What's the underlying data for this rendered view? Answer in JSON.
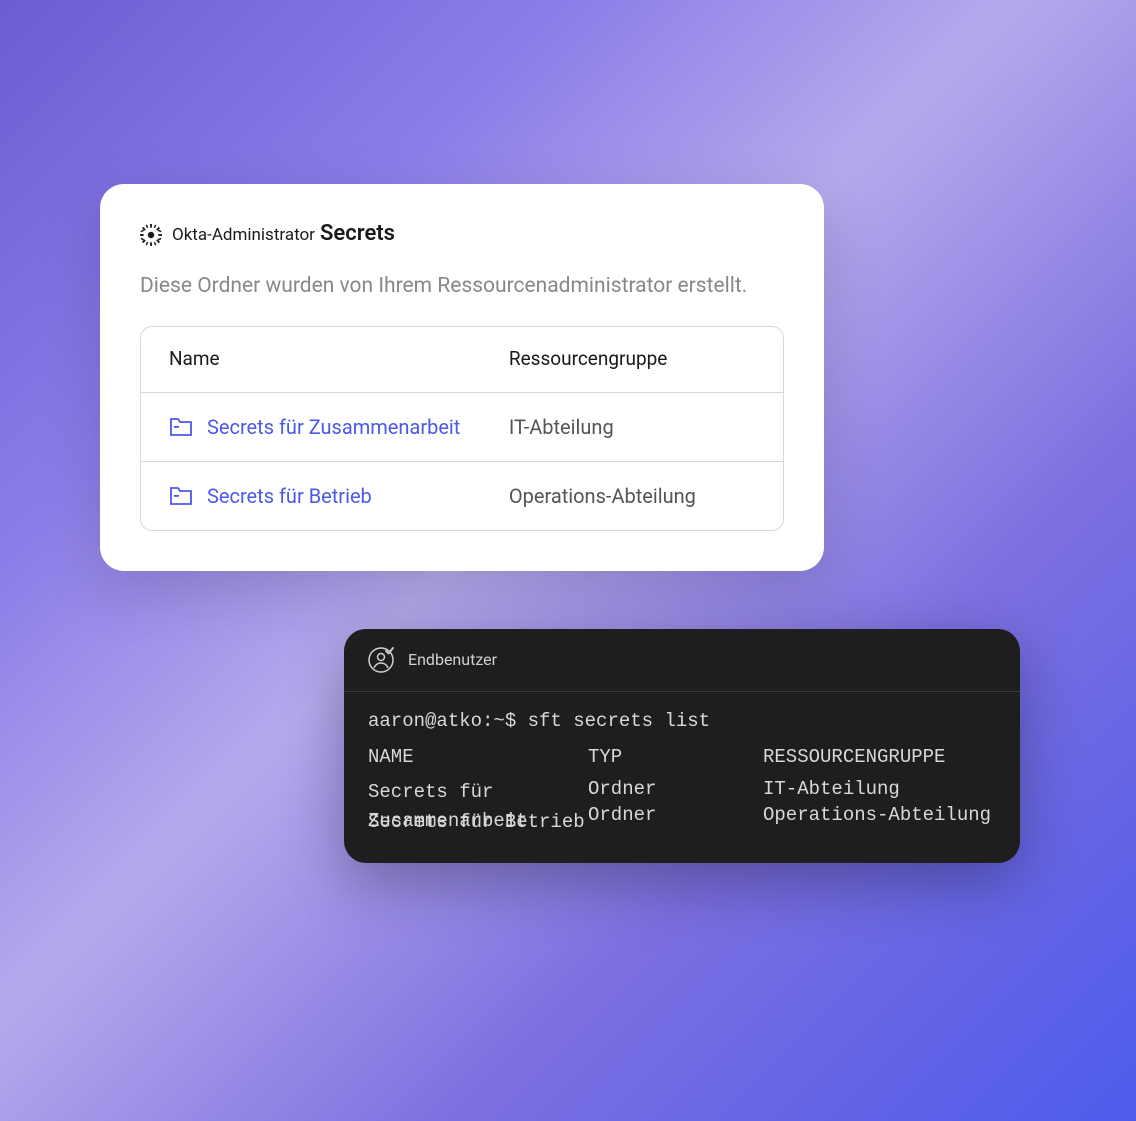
{
  "admin": {
    "brand_label": "Okta-Administrator",
    "page_title": "Secrets",
    "description": "Diese Ordner wurden von Ihrem Ressourcenadministrator erstellt.",
    "table": {
      "headers": {
        "name": "Name",
        "group": "Ressourcengruppe"
      },
      "rows": [
        {
          "name": "Secrets für Zusammenarbeit",
          "group": "IT-Abteilung"
        },
        {
          "name": "Secrets für Betrieb",
          "group": "Operations-Abteilung"
        }
      ]
    }
  },
  "terminal": {
    "title": "Endbenutzer",
    "prompt": "aaron@atko:~$ sft secrets list",
    "headers": {
      "name": "NAME",
      "type": "TYP",
      "group": "RESSOURCENGRUPPE"
    },
    "rows": [
      {
        "name": "Secrets für Zusammenarbeit",
        "type": "Ordner",
        "group": "IT-Abteilung"
      },
      {
        "name": "Secrets für Betrieb",
        "type": "Ordner",
        "group": "Operations-Abteilung"
      }
    ]
  }
}
